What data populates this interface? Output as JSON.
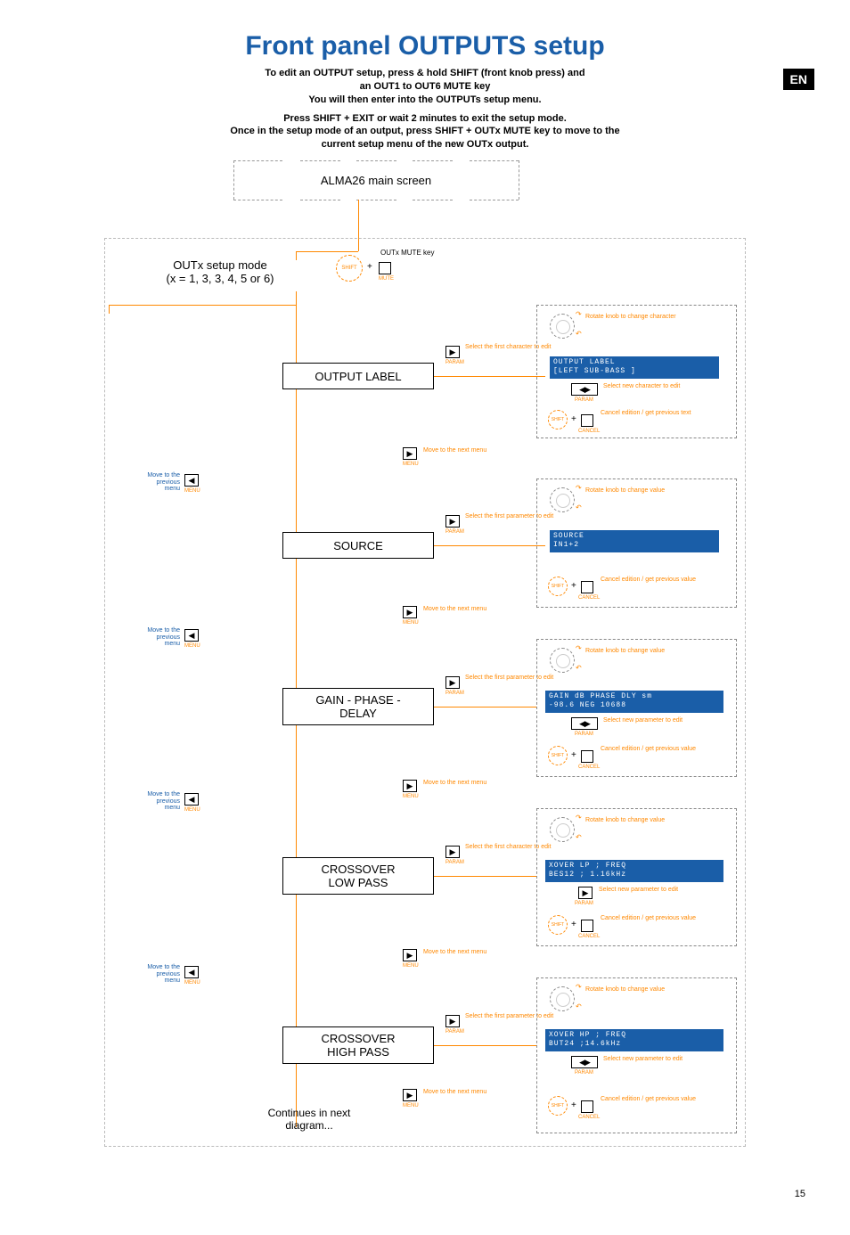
{
  "lang_badge": "EN",
  "page_number": "15",
  "title": "Front panel OUTPUTS setup",
  "intro": {
    "line1": "To edit an OUTPUT setup, press & hold SHIFT (front knob press) and",
    "line2": "an OUT1 to OUT6 MUTE key",
    "line3": "You will then enter into the OUTPUTs setup menu.",
    "line4": "Press SHIFT + EXIT or wait 2 minutes to exit the setup mode.",
    "line5": "Once in the setup mode of an output, press SHIFT + OUTx MUTE key to move to the",
    "line6": "current setup menu of the new OUTx output."
  },
  "main_screen": "ALMA26 main screen",
  "outx_mode": {
    "l1": "OUTx setup mode",
    "l2": "(x = 1, 3, 3, 4, 5 or 6)"
  },
  "outx_mute": "OUTx MUTE key",
  "shift": "SHIFT",
  "mute": "MUTE",
  "cancel": "CANCEL",
  "param": "PARAM",
  "menu": "MENU",
  "rotate_char": "Rotate knob to change character",
  "rotate_val": "Rotate knob to change value",
  "select_first_char": "Select the first character to edit",
  "select_first_param": "Select the first parameter to edit",
  "select_new_char": "Select new character to edit",
  "select_new_param": "Select new parameter to edit",
  "cancel_prev_text": "Cancel edition / get previous text",
  "cancel_prev_val": "Cancel edition / get previous value",
  "move_next": "Move to the next menu",
  "move_prev": "Move to the previous menu",
  "menus": {
    "output_label": "OUTPUT LABEL",
    "source": "SOURCE",
    "gain_phase_delay": {
      "l1": "GAIN - PHASE -",
      "l2": "DELAY"
    },
    "xover_lp": {
      "l1": "CROSSOVER",
      "l2": "LOW PASS"
    },
    "xover_hp": {
      "l1": "CROSSOVER",
      "l2": "HIGH PASS"
    }
  },
  "lcd": {
    "label": {
      "l1": "   OUTPUT  LABEL",
      "l2": "[LEFT SUB-BASS    ]"
    },
    "source": {
      "l1": "      SOURCE",
      "l2": "      IN1+2"
    },
    "gpd": {
      "l1": "GAIN dB PHASE DLY sm",
      "l2": "-98.6   NEG   10688"
    },
    "lp": {
      "l1": "XOVER LP ;  FREQ",
      "l2": "BES12    ; 1.16kHz"
    },
    "hp": {
      "l1": "XOVER HP ;  FREQ",
      "l2": "BUT24    ;14.6kHz"
    }
  },
  "continues": "Continues in next diagram..."
}
